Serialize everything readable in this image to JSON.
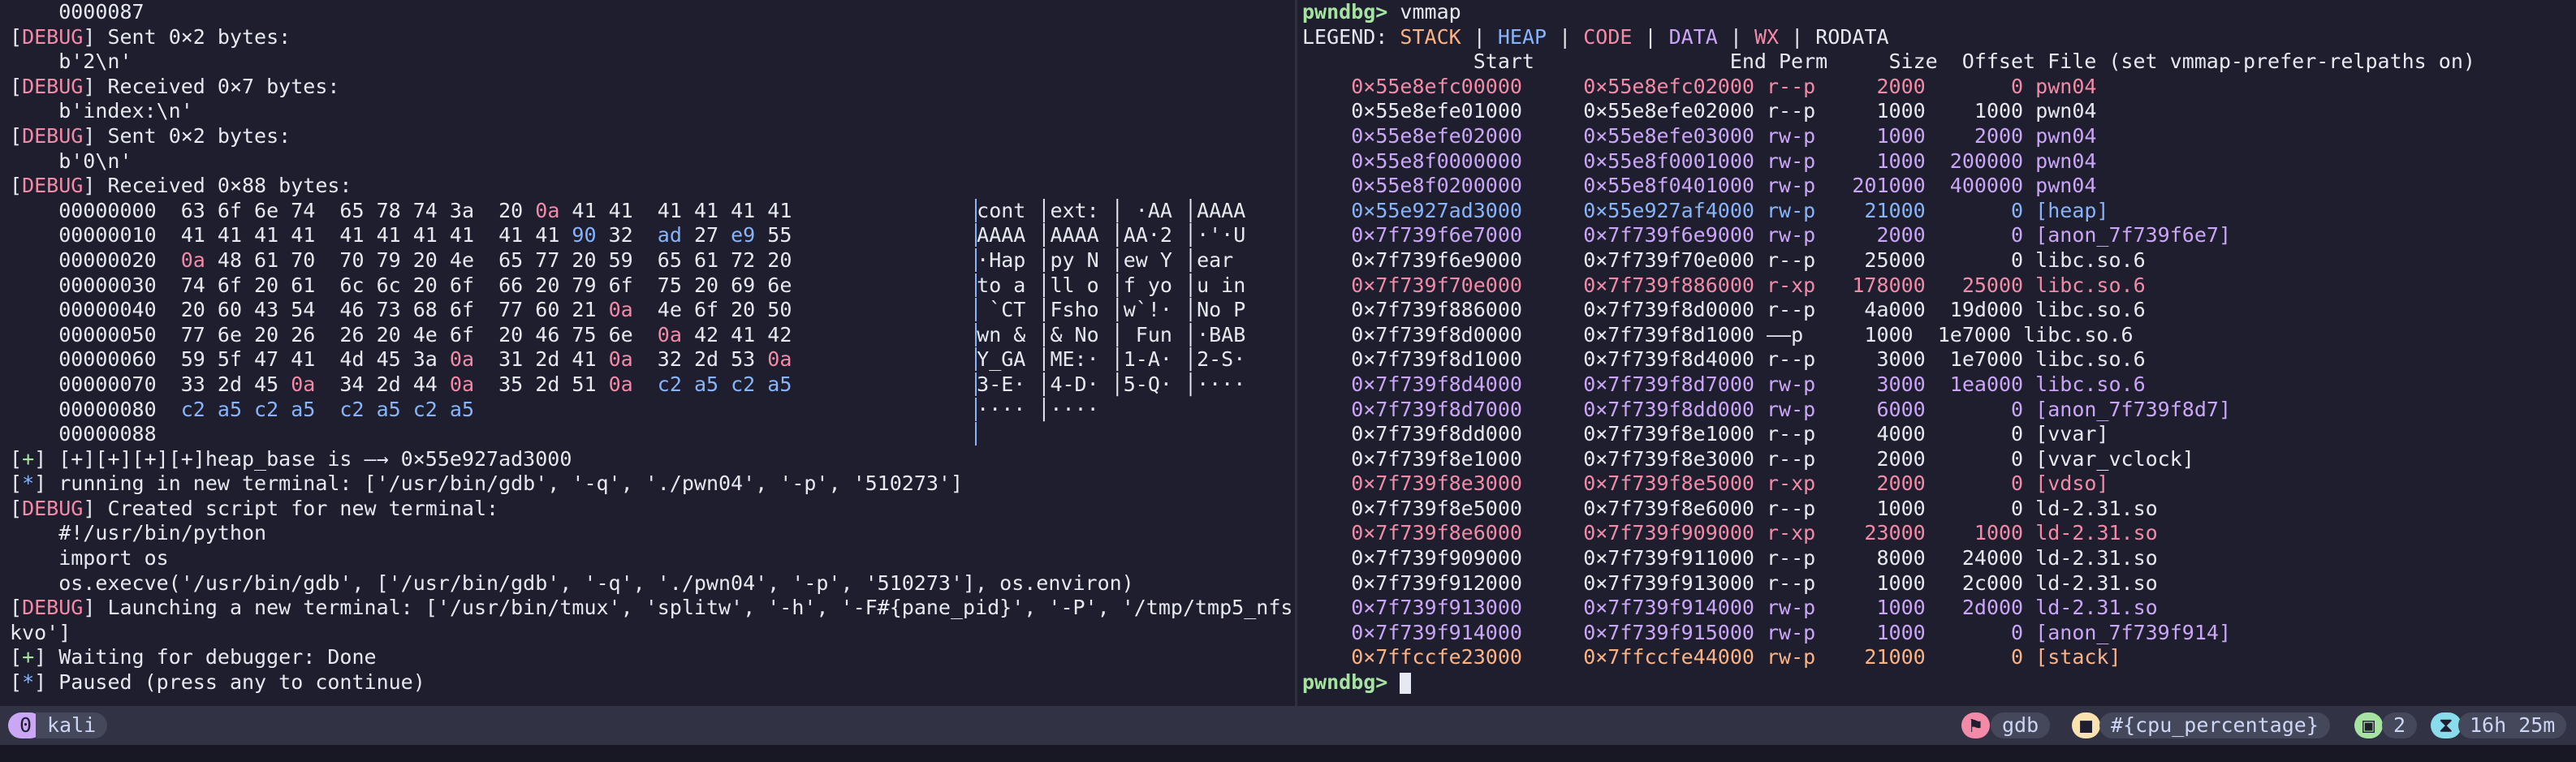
{
  "left_pane": {
    "lines": [
      {
        "prefix": "",
        "text": "    0000087"
      },
      {
        "prefix": "DEBUG",
        "text": " Sent 0×2 bytes:"
      },
      {
        "prefix": "",
        "text": "    b'2\\n'"
      },
      {
        "prefix": "DEBUG",
        "text": " Received 0×7 bytes:"
      },
      {
        "prefix": "",
        "text": "    b'index:\\n'"
      },
      {
        "prefix": "DEBUG",
        "text": " Sent 0×2 bytes:"
      },
      {
        "prefix": "",
        "text": "    b'0\\n'"
      },
      {
        "prefix": "DEBUG",
        "text": " Received 0×88 bytes:"
      }
    ],
    "hexdump": [
      {
        "offset": "00000000",
        "bytes": "63 6f 6e 74  65 78 74 3a  20 0a 41 41  41 41 41 41",
        "ascii": "cont │ext: │ ·AA │AAAA"
      },
      {
        "offset": "00000010",
        "bytes": "41 41 41 41  41 41 41 41  41 41 90 32  ad 27 e9 55",
        "ascii": "AAAA │AAAA │AA·2 │·'·U"
      },
      {
        "offset": "00000020",
        "bytes": "0a 48 61 70  70 79 20 4e  65 77 20 59  65 61 72 20",
        "ascii": "·Hap │py N │ew Y │ear "
      },
      {
        "offset": "00000030",
        "bytes": "74 6f 20 61  6c 6c 20 6f  66 20 79 6f  75 20 69 6e",
        "ascii": "to a │ll o │f yo │u in"
      },
      {
        "offset": "00000040",
        "bytes": "20 60 43 54  46 73 68 6f  77 60 21 0a  4e 6f 20 50",
        "ascii": " `CT │Fsho │w`!· │No P"
      },
      {
        "offset": "00000050",
        "bytes": "77 6e 20 26  26 20 4e 6f  20 46 75 6e  0a 42 41 42",
        "ascii": "wn & │& No │ Fun │·BAB"
      },
      {
        "offset": "00000060",
        "bytes": "59 5f 47 41  4d 45 3a 0a  31 2d 41 0a  32 2d 53 0a",
        "ascii": "Y_GA │ME:· │1-A· │2-S·"
      },
      {
        "offset": "00000070",
        "bytes": "33 2d 45 0a  34 2d 44 0a  35 2d 51 0a  c2 a5 c2 a5",
        "ascii": "3-E· │4-D· │5-Q· │····"
      },
      {
        "offset": "00000080",
        "bytes": "c2 a5 c2 a5  c2 a5 c2 a5",
        "ascii": "···· │····"
      },
      {
        "offset": "00000088",
        "bytes": "",
        "ascii": ""
      }
    ],
    "tail": [
      {
        "prefix": "+",
        "text": " [+][+][+][+]heap_base is —→ 0×55e927ad3000"
      },
      {
        "prefix": "*",
        "text": " running in new terminal: ['/usr/bin/gdb', '-q', './pwn04', '-p', '510273']"
      },
      {
        "prefix": "DEBUG",
        "text": " Created script for new terminal:"
      },
      {
        "prefix": "",
        "text": "    #!/usr/bin/python"
      },
      {
        "prefix": "",
        "text": "    import os"
      },
      {
        "prefix": "",
        "text": "    os.execve('/usr/bin/gdb', ['/usr/bin/gdb', '-q', './pwn04', '-p', '510273'], os.environ)"
      },
      {
        "prefix": "DEBUG",
        "text": " Launching a new terminal: ['/usr/bin/tmux', 'splitw', '-h', '-F#{pane_pid}', '-P', '/tmp/tmp5_nfs"
      },
      {
        "prefix": "",
        "text": "kvo']"
      },
      {
        "prefix": "+",
        "text": " Waiting for debugger: Done"
      },
      {
        "prefix": "*",
        "text": " Paused (press any to continue)"
      }
    ]
  },
  "right_pane": {
    "prompt": "pwndbg>",
    "command": " vmmap",
    "legend_label": "LEGEND: ",
    "legend": [
      "STACK",
      "HEAP",
      "CODE",
      "DATA",
      "WX",
      "RODATA"
    ],
    "header": "              Start                End Perm     Size  Offset File (set vmmap-prefer-relpaths on)",
    "rows": [
      {
        "start": "0×55e8efc00000",
        "end": "0×55e8efc02000",
        "perm": "r--p",
        "size": "2000",
        "offset": "0",
        "file": "pwn04",
        "cls": "c-code"
      },
      {
        "start": "0×55e8efe01000",
        "end": "0×55e8efe02000",
        "perm": "r--p",
        "size": "1000",
        "offset": "1000",
        "file": "pwn04",
        "cls": "c-ro"
      },
      {
        "start": "0×55e8efe02000",
        "end": "0×55e8efe03000",
        "perm": "rw-p",
        "size": "1000",
        "offset": "2000",
        "file": "pwn04",
        "cls": "c-data"
      },
      {
        "start": "0×55e8f0000000",
        "end": "0×55e8f0001000",
        "perm": "rw-p",
        "size": "1000",
        "offset": "200000",
        "file": "pwn04",
        "cls": "c-data"
      },
      {
        "start": "0×55e8f0200000",
        "end": "0×55e8f0401000",
        "perm": "rw-p",
        "size": "201000",
        "offset": "400000",
        "file": "pwn04",
        "cls": "c-data"
      },
      {
        "start": "0×55e927ad3000",
        "end": "0×55e927af4000",
        "perm": "rw-p",
        "size": "21000",
        "offset": "0",
        "file": "[heap]",
        "cls": "c-heap"
      },
      {
        "start": "0×7f739f6e7000",
        "end": "0×7f739f6e9000",
        "perm": "rw-p",
        "size": "2000",
        "offset": "0",
        "file": "[anon_7f739f6e7]",
        "cls": "c-data"
      },
      {
        "start": "0×7f739f6e9000",
        "end": "0×7f739f70e000",
        "perm": "r--p",
        "size": "25000",
        "offset": "0",
        "file": "libc.so.6",
        "cls": "c-ro"
      },
      {
        "start": "0×7f739f70e000",
        "end": "0×7f739f886000",
        "perm": "r-xp",
        "size": "178000",
        "offset": "25000",
        "file": "libc.so.6",
        "cls": "c-code"
      },
      {
        "start": "0×7f739f886000",
        "end": "0×7f739f8d0000",
        "perm": "r--p",
        "size": "4a000",
        "offset": "19d000",
        "file": "libc.so.6",
        "cls": "c-ro"
      },
      {
        "start": "0×7f739f8d0000",
        "end": "0×7f739f8d1000",
        "perm": "——p",
        "size": "1000",
        "offset": "1e7000",
        "file": "libc.so.6",
        "cls": "c-ro"
      },
      {
        "start": "0×7f739f8d1000",
        "end": "0×7f739f8d4000",
        "perm": "r--p",
        "size": "3000",
        "offset": "1e7000",
        "file": "libc.so.6",
        "cls": "c-ro"
      },
      {
        "start": "0×7f739f8d4000",
        "end": "0×7f739f8d7000",
        "perm": "rw-p",
        "size": "3000",
        "offset": "1ea000",
        "file": "libc.so.6",
        "cls": "c-data"
      },
      {
        "start": "0×7f739f8d7000",
        "end": "0×7f739f8dd000",
        "perm": "rw-p",
        "size": "6000",
        "offset": "0",
        "file": "[anon_7f739f8d7]",
        "cls": "c-data"
      },
      {
        "start": "0×7f739f8dd000",
        "end": "0×7f739f8e1000",
        "perm": "r--p",
        "size": "4000",
        "offset": "0",
        "file": "[vvar]",
        "cls": "c-ro"
      },
      {
        "start": "0×7f739f8e1000",
        "end": "0×7f739f8e3000",
        "perm": "r--p",
        "size": "2000",
        "offset": "0",
        "file": "[vvar_vclock]",
        "cls": "c-ro"
      },
      {
        "start": "0×7f739f8e3000",
        "end": "0×7f739f8e5000",
        "perm": "r-xp",
        "size": "2000",
        "offset": "0",
        "file": "[vdso]",
        "cls": "c-code"
      },
      {
        "start": "0×7f739f8e5000",
        "end": "0×7f739f8e6000",
        "perm": "r--p",
        "size": "1000",
        "offset": "0",
        "file": "ld-2.31.so",
        "cls": "c-ro"
      },
      {
        "start": "0×7f739f8e6000",
        "end": "0×7f739f909000",
        "perm": "r-xp",
        "size": "23000",
        "offset": "1000",
        "file": "ld-2.31.so",
        "cls": "c-code"
      },
      {
        "start": "0×7f739f909000",
        "end": "0×7f739f911000",
        "perm": "r--p",
        "size": "8000",
        "offset": "24000",
        "file": "ld-2.31.so",
        "cls": "c-ro"
      },
      {
        "start": "0×7f739f912000",
        "end": "0×7f739f913000",
        "perm": "r--p",
        "size": "1000",
        "offset": "2c000",
        "file": "ld-2.31.so",
        "cls": "c-ro"
      },
      {
        "start": "0×7f739f913000",
        "end": "0×7f739f914000",
        "perm": "rw-p",
        "size": "1000",
        "offset": "2d000",
        "file": "ld-2.31.so",
        "cls": "c-data"
      },
      {
        "start": "0×7f739f914000",
        "end": "0×7f739f915000",
        "perm": "rw-p",
        "size": "1000",
        "offset": "0",
        "file": "[anon_7f739f914]",
        "cls": "c-data"
      },
      {
        "start": "0×7ffccfe23000",
        "end": "0×7ffccfe44000",
        "perm": "rw-p",
        "size": "21000",
        "offset": "0",
        "file": "[stack]",
        "cls": "c-stack"
      }
    ],
    "final_prompt": "pwndbg>"
  },
  "status_bar": {
    "session_index": "0",
    "session_name": "kali",
    "pane_cmd": "gdb",
    "cpu": "#{cpu_percentage}",
    "window_count": "2",
    "uptime": "16h 25m"
  }
}
